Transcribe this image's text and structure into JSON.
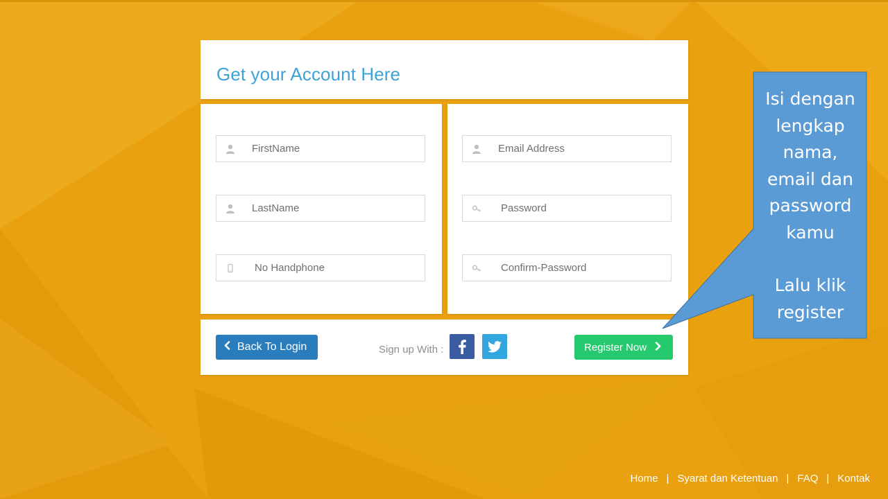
{
  "header": {
    "title": "Get your Account Here"
  },
  "form": {
    "first_name": {
      "placeholder": "FirstName",
      "icon": "user-icon"
    },
    "last_name": {
      "placeholder": "LastName",
      "icon": "user-icon"
    },
    "phone": {
      "placeholder": "No Handphone",
      "icon": "mobile-phone-icon"
    },
    "email": {
      "placeholder": "Email Address",
      "icon": "user-icon"
    },
    "password": {
      "placeholder": "Password",
      "icon": "key-icon"
    },
    "confirm_password": {
      "placeholder": "Confirm-Password",
      "icon": "key-icon"
    }
  },
  "actions": {
    "back_label": "Back To Login",
    "signup_label": "Sign up With :",
    "register_label": "Register Now",
    "back_color": "#2a7dbc",
    "register_color": "#27c96f",
    "facebook_color": "#3b5ba0",
    "twitter_color": "#33a6df"
  },
  "callout": {
    "lines": [
      "Isi dengan",
      "lengkap",
      "nama,",
      "email dan",
      "password",
      "kamu"
    ],
    "lines2": [
      "Lalu klik",
      "register"
    ],
    "color": "#5b9bd5"
  },
  "footer": {
    "links": [
      "Home",
      "Syarat dan Ketentuan",
      "FAQ",
      "Kontak"
    ],
    "separator": "|"
  },
  "colors": {
    "background": "#eaa10f",
    "title": "#3ea2d6"
  }
}
